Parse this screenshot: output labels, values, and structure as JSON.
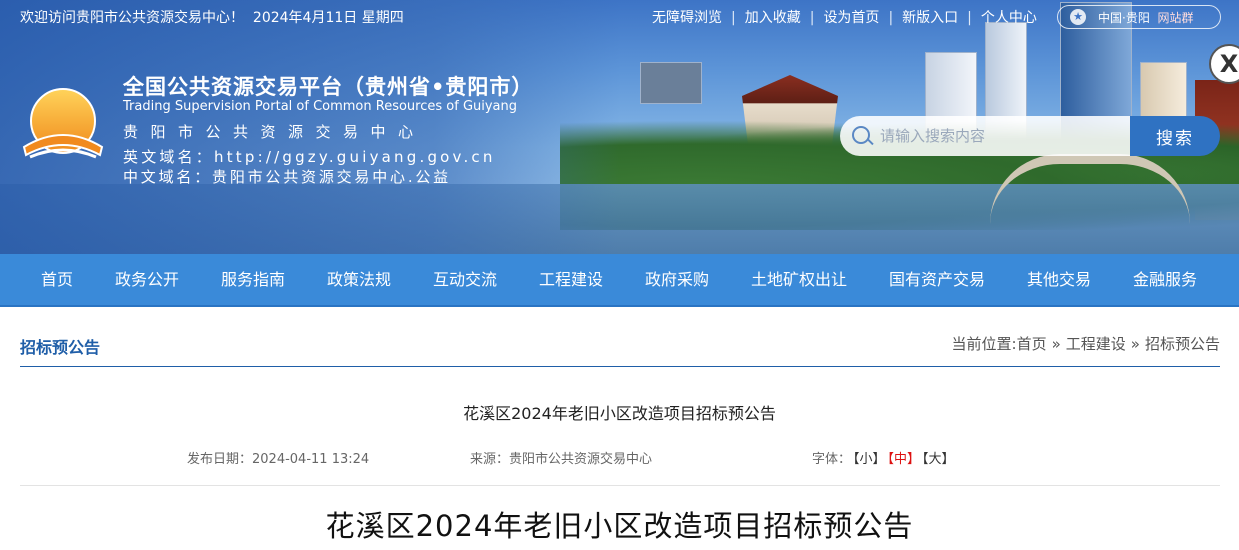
{
  "topbar": {
    "welcome": "欢迎访问贵阳市公共资源交易中心！",
    "date": "2024年4月11日 星期四",
    "links": [
      "无障碍浏览",
      "加入收藏",
      "设为首页",
      "新版入口",
      "个人中心"
    ],
    "sep": "|",
    "pill_prefix": "中国·贵阳",
    "pill_suffix": "网站群"
  },
  "close": {
    "label": "X"
  },
  "site": {
    "title": "全国公共资源交易平台（贵州省•贵阳市）",
    "title_en": "Trading Supervision Portal of Common Resources of Guiyang",
    "name_cn": "贵阳市公共资源交易中心",
    "domain_en_label": "英文域名：",
    "domain_en": "http://ggzy.guiyang.gov.cn",
    "domain_cn_label": "中文域名：",
    "domain_cn": "贵阳市公共资源交易中心.公益"
  },
  "search": {
    "placeholder": "请输入搜索内容",
    "button": "搜索"
  },
  "nav": [
    "首页",
    "政务公开",
    "服务指南",
    "政策法规",
    "互动交流",
    "工程建设",
    "政府采购",
    "土地矿权出让",
    "国有资产交易",
    "其他交易",
    "金融服务"
  ],
  "breadcrumb": {
    "section": "招标预公告",
    "prefix": "当前位置:",
    "path": [
      "首页",
      "工程建设",
      "招标预公告"
    ],
    "sep": "»"
  },
  "article": {
    "title": "花溪区2024年老旧小区改造项目招标预公告",
    "date_label": "发布日期：",
    "date": "2024-04-11 13:24",
    "source_label": "来源：",
    "source": "贵阳市公共资源交易中心",
    "font_label": "字体：",
    "font_sizes": [
      "【小】",
      "【中】",
      "【大】"
    ],
    "heading": "花溪区2024年老旧小区改造项目招标预公告"
  },
  "colors": {
    "nav_bg": "#3a8ad9",
    "accent": "#1f5ea8",
    "active_font": "#dd1111"
  }
}
